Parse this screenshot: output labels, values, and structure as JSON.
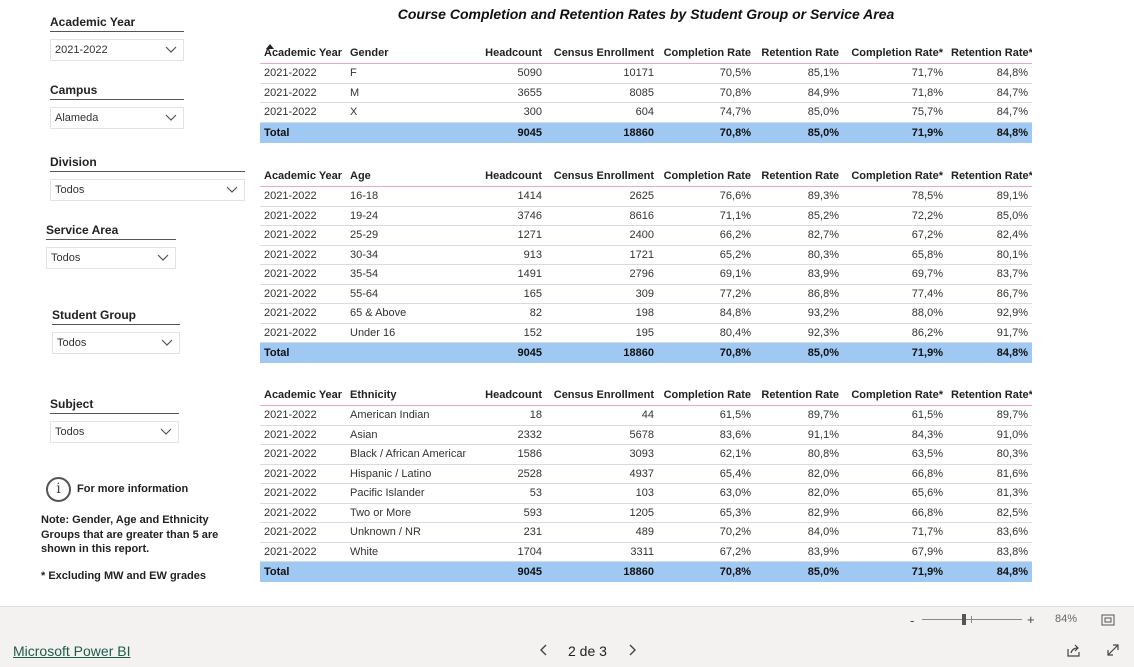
{
  "report": {
    "title": "Course Completion and Retention Rates by Student Group or Service Area",
    "info_label": "For more information",
    "note": "Note:  Gender, Age and Ethnicity Groups that are greater than  5 are shown in this report.",
    "footnote": "* Excluding MW and EW grades"
  },
  "slicers": [
    {
      "label": "Academic Year",
      "value": "2021-2022"
    },
    {
      "label": "Campus",
      "value": "Alameda"
    },
    {
      "label": "Division",
      "value": "Todos"
    },
    {
      "label": "Service Area",
      "value": "Todos"
    },
    {
      "label": "Student Group",
      "value": "Todos"
    },
    {
      "label": "Subject",
      "value": "Todos"
    }
  ],
  "tables": {
    "gender": {
      "headers": [
        "Academic Year",
        "Gender",
        "Headcount",
        "Census Enrollment",
        "Completion Rate",
        "Retention Rate",
        "Completion Rate*",
        "Retention Rate*"
      ],
      "rows": [
        [
          "2021-2022",
          "F",
          "5090",
          "10171",
          "70,5%",
          "85,1%",
          "71,7%",
          "84,8%"
        ],
        [
          "2021-2022",
          "M",
          "3655",
          "8085",
          "70,8%",
          "84,9%",
          "71,8%",
          "84,7%"
        ],
        [
          "2021-2022",
          "X",
          "300",
          "604",
          "74,7%",
          "85,0%",
          "75,7%",
          "84,7%"
        ]
      ],
      "total": [
        "Total",
        "",
        "9045",
        "18860",
        "70,8%",
        "85,0%",
        "71,9%",
        "84,8%"
      ]
    },
    "age": {
      "headers": [
        "Academic Year",
        "Age",
        "Headcount",
        "Census Enrollment",
        "Completion Rate",
        "Retention Rate",
        "Completion Rate*",
        "Retention Rate*"
      ],
      "rows": [
        [
          "2021-2022",
          "16-18",
          "1414",
          "2625",
          "76,6%",
          "89,3%",
          "78,5%",
          "89,1%"
        ],
        [
          "2021-2022",
          "19-24",
          "3746",
          "8616",
          "71,1%",
          "85,2%",
          "72,2%",
          "85,0%"
        ],
        [
          "2021-2022",
          "25-29",
          "1271",
          "2400",
          "66,2%",
          "82,7%",
          "67,2%",
          "82,4%"
        ],
        [
          "2021-2022",
          "30-34",
          "913",
          "1721",
          "65,2%",
          "80,3%",
          "65,8%",
          "80,1%"
        ],
        [
          "2021-2022",
          "35-54",
          "1491",
          "2796",
          "69,1%",
          "83,9%",
          "69,7%",
          "83,7%"
        ],
        [
          "2021-2022",
          "55-64",
          "165",
          "309",
          "77,2%",
          "86,8%",
          "77,4%",
          "86,7%"
        ],
        [
          "2021-2022",
          "65 & Above",
          "82",
          "198",
          "84,8%",
          "93,2%",
          "88,0%",
          "92,9%"
        ],
        [
          "2021-2022",
          "Under 16",
          "152",
          "195",
          "80,4%",
          "92,3%",
          "86,2%",
          "91,7%"
        ]
      ],
      "total": [
        "Total",
        "",
        "9045",
        "18860",
        "70,8%",
        "85,0%",
        "71,9%",
        "84,8%"
      ]
    },
    "ethnicity": {
      "headers": [
        "Academic Year",
        "Ethnicity",
        "Headcount",
        "Census Enrollment",
        "Completion Rate",
        "Retention Rate",
        "Completion Rate*",
        "Retention Rate*"
      ],
      "rows": [
        [
          "2021-2022",
          "American Indian",
          "18",
          "44",
          "61,5%",
          "89,7%",
          "61,5%",
          "89,7%"
        ],
        [
          "2021-2022",
          "Asian",
          "2332",
          "5678",
          "83,6%",
          "91,1%",
          "84,3%",
          "91,0%"
        ],
        [
          "2021-2022",
          "Black / African American",
          "1586",
          "3093",
          "62,1%",
          "80,8%",
          "63,5%",
          "80,3%"
        ],
        [
          "2021-2022",
          "Hispanic / Latino",
          "2528",
          "4937",
          "65,4%",
          "82,0%",
          "66,8%",
          "81,6%"
        ],
        [
          "2021-2022",
          "Pacific Islander",
          "53",
          "103",
          "63,0%",
          "82,0%",
          "65,6%",
          "81,3%"
        ],
        [
          "2021-2022",
          "Two or More",
          "593",
          "1205",
          "65,3%",
          "82,9%",
          "66,8%",
          "82,5%"
        ],
        [
          "2021-2022",
          "Unknown / NR",
          "231",
          "489",
          "70,2%",
          "84,0%",
          "71,7%",
          "83,6%"
        ],
        [
          "2021-2022",
          "White",
          "1704",
          "3311",
          "67,2%",
          "83,9%",
          "67,9%",
          "83,8%"
        ]
      ],
      "total": [
        "Total",
        "",
        "9045",
        "18860",
        "70,8%",
        "85,0%",
        "71,9%",
        "84,8%"
      ]
    }
  },
  "footer": {
    "brand": "Microsoft Power BI",
    "page_indicator": "2 de 3",
    "zoom_level": "84%",
    "zoom_out": "-",
    "zoom_in": "+"
  },
  "colors": {
    "total_row": "#9fc9f3",
    "header_underline": "#f0a8c0",
    "brand_link": "#1e5c4a"
  },
  "icons": [
    "chevron-down-icon",
    "info-icon",
    "sort-ascending-icon",
    "chevron-left-icon",
    "chevron-right-icon",
    "share-icon",
    "fullscreen-icon",
    "fit-page-icon"
  ]
}
